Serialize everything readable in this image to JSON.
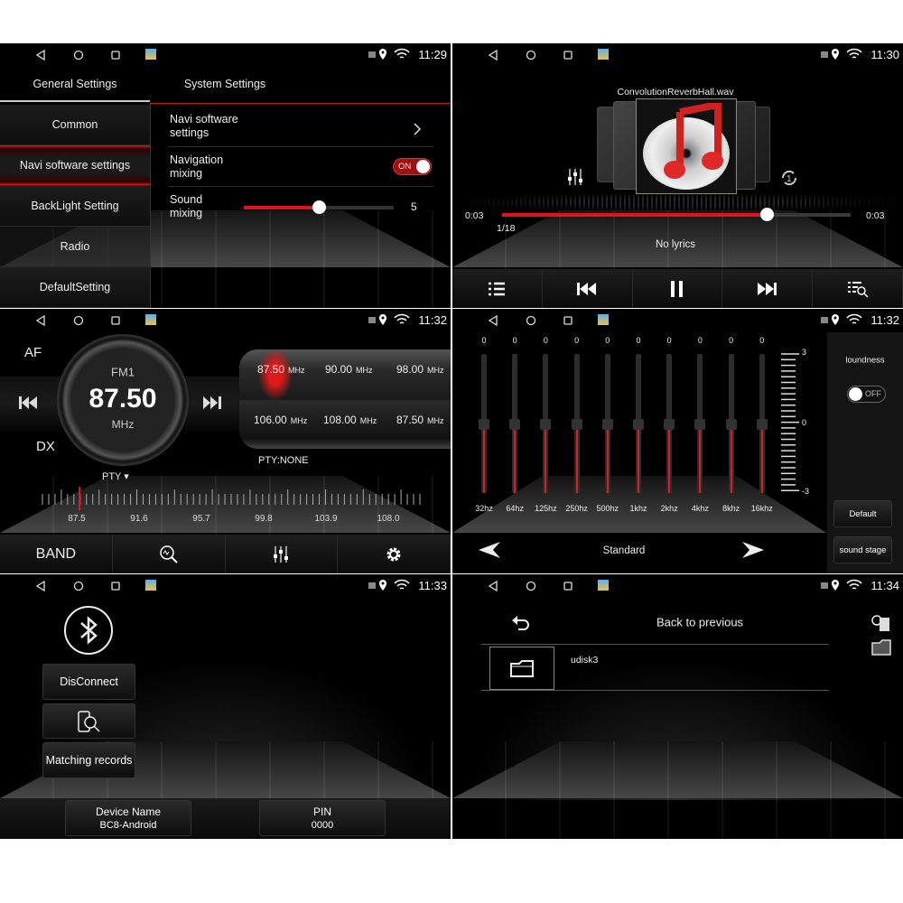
{
  "status_times": [
    "11:29",
    "11:30",
    "11:32",
    "11:32",
    "11:33",
    "11:34"
  ],
  "accent_color": "#e0141e",
  "settings": {
    "tabs": [
      "General Settings",
      "System Settings"
    ],
    "menu": [
      "Common",
      "Navi software settings",
      "BackLight Setting",
      "Radio",
      "DefaultSetting"
    ],
    "selected_menu": "Navi software settings",
    "rows": {
      "navi_software": "Navi software settings",
      "navigation_mixing": "Navigation mixing",
      "navigation_mixing_state": "ON",
      "sound_mixing": "Sound mixing",
      "sound_mixing_value": "5"
    }
  },
  "music": {
    "title": "ConvolutionReverbHall.wav",
    "elapsed": "0:03",
    "total": "0:03",
    "progress": 0.76,
    "track_index": "1/18",
    "lyrics": "No lyrics",
    "controls": [
      "playlist-icon",
      "previous-icon",
      "pause-icon",
      "next-icon",
      "search-list-icon"
    ]
  },
  "radio": {
    "af": "AF",
    "dx": "DX",
    "band": "FM1",
    "frequency": "87.50",
    "unit": "MHz",
    "presets": [
      {
        "f": "87.50",
        "u": "MHz"
      },
      {
        "f": "90.00",
        "u": "MHz"
      },
      {
        "f": "98.00",
        "u": "MHz"
      },
      {
        "f": "106.00",
        "u": "MHz"
      },
      {
        "f": "108.00",
        "u": "MHz"
      },
      {
        "f": "87.50",
        "u": "MHz"
      }
    ],
    "pty_status": "PTY:NONE",
    "pty": "PTY",
    "scale": [
      "87.5",
      "91.6",
      "95.7",
      "99.8",
      "103.9",
      "108.0"
    ],
    "band_label": "BAND"
  },
  "eq": {
    "values": [
      "0",
      "0",
      "0",
      "0",
      "0",
      "0",
      "0",
      "0",
      "0",
      "0"
    ],
    "bands": [
      "32hz",
      "64hz",
      "125hz",
      "250hz",
      "500hz",
      "1khz",
      "2khz",
      "4khz",
      "8khz",
      "16khz"
    ],
    "scale_max": "3",
    "scale_mid": "0",
    "scale_min": "-3",
    "loudness": "loundness",
    "loudness_state": "OFF",
    "default": "Default",
    "sound_stage": "sound stage",
    "preset": "Standard"
  },
  "bluetooth": {
    "disconnect": "DisConnect",
    "matching": "Matching records",
    "device_label": "Device Name",
    "device_value": "BC8-Android",
    "pin_label": "PIN",
    "pin_value": "0000"
  },
  "files": {
    "back": "Back to previous",
    "folder": "udisk3"
  }
}
